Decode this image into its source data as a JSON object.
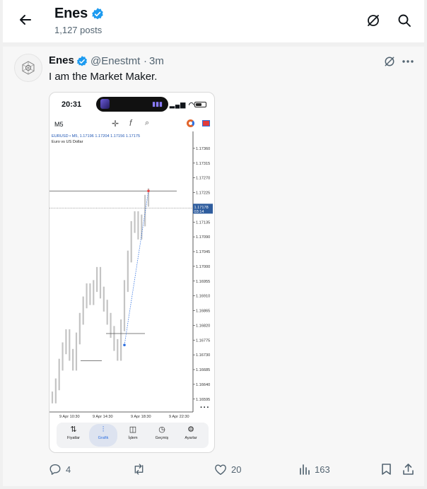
{
  "header": {
    "name": "Enes",
    "post_count": "1,127 posts"
  },
  "post": {
    "author_name": "Enes",
    "author_handle": "@Enestmt",
    "separator": "·",
    "time": "3m",
    "text": "I am the Market Maker."
  },
  "screenshot": {
    "status_time": "20:31",
    "timeframe": "M5",
    "symbol_line": "EURUSD • M5, 1.17196 1.17204 1.17156 1.17175",
    "symbol_desc": "Euro vs US Dollar",
    "current_price": "1.17178",
    "countdown": "03:14",
    "nav": [
      {
        "label": "Fiyatlar",
        "icon": "arrows-icon"
      },
      {
        "label": "Grafik",
        "icon": "candles-icon"
      },
      {
        "label": "İşlem",
        "icon": "chart-line-icon"
      },
      {
        "label": "Geçmiş",
        "icon": "clock-icon"
      },
      {
        "label": "Ayarlar",
        "icon": "gear-icon"
      }
    ]
  },
  "chart_data": {
    "type": "line",
    "title": "",
    "price_scale": [
      "1.17360",
      "1.17315",
      "1.17270",
      "1.17225",
      "1.17135",
      "1.17090",
      "1.17045",
      "1.17000",
      "1.16955",
      "1.16910",
      "1.16865",
      "1.16820",
      "1.16775",
      "1.16730",
      "1.16685",
      "1.16640",
      "1.16595"
    ],
    "time_labels": [
      "9 Apr 10:30",
      "9 Apr 14:30",
      "9 Apr 18:30",
      "9 Apr 22:30"
    ],
    "price_range": [
      1.1656,
      1.1739
    ],
    "series": [
      {
        "values": [
          1.166,
          1.1664,
          1.167,
          1.1675,
          1.1679,
          1.1673,
          1.167,
          1.1678,
          1.1684,
          1.1689,
          1.1693,
          1.169,
          1.1694,
          1.1698,
          1.1692,
          1.1688,
          1.1684,
          1.168,
          1.1676,
          1.1673,
          1.1682,
          1.1694,
          1.1703,
          1.1712,
          1.1715,
          1.171,
          1.1714,
          1.172,
          1.1722
        ]
      }
    ],
    "levels": [
      1.1723,
      1.16795,
      1.16712
    ],
    "colors": {
      "candles": "#c4c4c4",
      "level": "#555555",
      "trend": "#2d6fe0",
      "price_tag": "#2f5d9e",
      "marker": "#e84545"
    }
  },
  "actions": {
    "replies": "4",
    "reposts": "",
    "likes": "20",
    "views": "163"
  }
}
